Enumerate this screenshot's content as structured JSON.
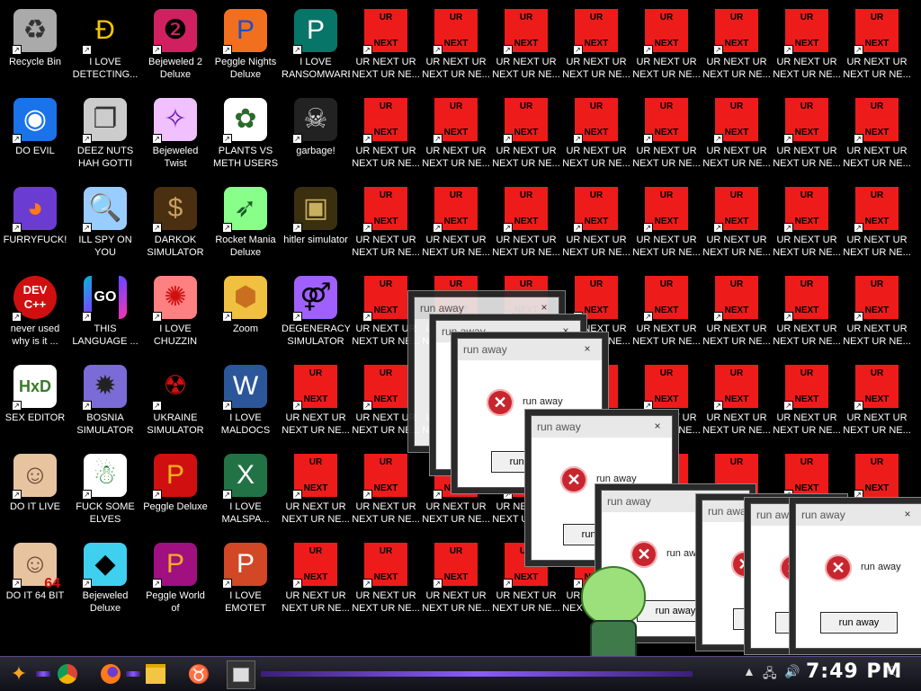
{
  "desktop": {
    "icons_col1": [
      "Recycle Bin",
      "DO EVIL",
      "FURRYFUCK!",
      "never used\nwhy is it ...",
      "SEX EDITOR",
      "DO IT LIVE",
      "DO IT 64 BIT"
    ],
    "icons_col2": [
      "I LOVE\nDETECTING...",
      "DEEZ NUTS\nHAH GOTTI",
      "ILL SPY ON\nYOU",
      "THIS\nLANGUAGE ...",
      "BOSNIA\nSIMULATOR",
      "FUCK SOME\nELVES",
      "Bejeweled\nDeluxe"
    ],
    "icons_col3": [
      "Bejeweled 2\nDeluxe",
      "Bejeweled\nTwist",
      "DARKOK\nSIMULATOR",
      "I LOVE\nCHUZZIN",
      "UKRAINE\nSIMULATOR",
      "Peggle Deluxe",
      "Peggle World of\nWarcraft Edition"
    ],
    "icons_col4": [
      "Peggle Nights\nDeluxe",
      "PLANTS VS\nMETH USERS",
      "Rocket Mania\nDeluxe",
      "Zoom",
      "I LOVE\nMALDOCS",
      "I LOVE\nMALSPA...",
      "I LOVE EMOTET"
    ],
    "icons_col5": [
      "I LOVE\nRANSOMWARE",
      "garbage!",
      "hitler simulator",
      "DEGENERACY\nSIMULATOR"
    ],
    "ur_label": "UR NEXT UR\nNEXT UR NE...",
    "ur_top": "UR",
    "ur_bottom": "NEXT",
    "devcpp_top": "DEV",
    "devcpp_bottom": "C++",
    "go_text": "GO",
    "hxd_text": "HxD",
    "num64": "64"
  },
  "dialog": {
    "title": "run away",
    "message": "run away",
    "button": "run away",
    "close": "×"
  },
  "taskbar": {
    "time": "7:49 PM"
  },
  "colors": {
    "ur_red": "#ee1b1b",
    "error_red": "#c8262f",
    "accent_purple": "#8a5cff"
  }
}
